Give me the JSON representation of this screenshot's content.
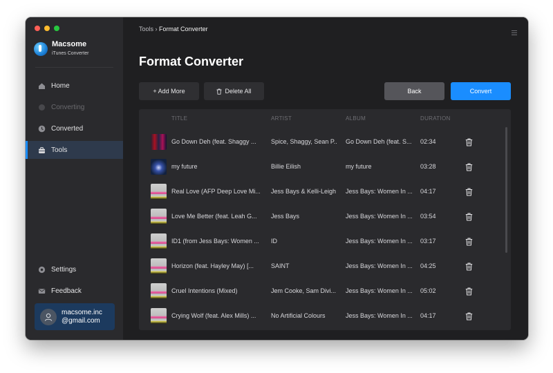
{
  "window": {
    "traffic_lights": [
      "close",
      "minimize",
      "zoom"
    ]
  },
  "sidebar": {
    "brand_name": "Macsome",
    "brand_subtitle": "iTunes Converter",
    "items": [
      {
        "label": "Home",
        "icon": "home-icon",
        "state": "normal"
      },
      {
        "label": "Converting",
        "icon": "converting-icon",
        "state": "disabled"
      },
      {
        "label": "Converted",
        "icon": "clock-icon",
        "state": "normal"
      },
      {
        "label": "Tools",
        "icon": "toolbox-icon",
        "state": "active"
      }
    ],
    "bottom_items": [
      {
        "label": "Settings",
        "icon": "gear-icon"
      },
      {
        "label": "Feedback",
        "icon": "mail-icon"
      }
    ],
    "user": {
      "line1": "macsome.inc",
      "line2": "@gmail.com"
    }
  },
  "header": {
    "breadcrumb_parent": "Tools",
    "breadcrumb_separator": "›",
    "breadcrumb_current": "Format Converter"
  },
  "main": {
    "title": "Format Converter",
    "buttons": {
      "add_more": "+ Add More",
      "delete_all": "Delete All",
      "back": "Back",
      "convert": "Convert"
    },
    "accent_color": "#1a8dff",
    "table": {
      "columns": [
        "TITLE",
        "ARTIST",
        "ALBUM",
        "DURATION"
      ],
      "rows": [
        {
          "thumb": "t1",
          "title": "Go Down Deh (feat. Shaggy ...",
          "artist": "Spice, Shaggy, Sean P...",
          "album": "Go Down Deh (feat. S...",
          "duration": "02:34"
        },
        {
          "thumb": "t2",
          "title": "my future",
          "artist": "Billie Eilish",
          "album": "my future",
          "duration": "03:28"
        },
        {
          "thumb": "t3",
          "title": "Real Love (AFP Deep Love Mi...",
          "artist": "Jess Bays & Kelli-Leigh",
          "album": "Jess Bays: Women In ...",
          "duration": "04:17"
        },
        {
          "thumb": "t3",
          "title": "Love Me Better (feat. Leah G...",
          "artist": "Jess Bays",
          "album": "Jess Bays: Women In ...",
          "duration": "03:54"
        },
        {
          "thumb": "t3",
          "title": "ID1 (from Jess Bays: Women ...",
          "artist": "ID",
          "album": "Jess Bays: Women In ...",
          "duration": "03:17"
        },
        {
          "thumb": "t3",
          "title": "Horizon (feat. Hayley May) [...",
          "artist": "SAINT",
          "album": "Jess Bays: Women In ...",
          "duration": "04:25"
        },
        {
          "thumb": "t3",
          "title": "Cruel Intentions (Mixed)",
          "artist": "Jem Cooke, Sam Divi...",
          "album": "Jess Bays: Women In ...",
          "duration": "05:02"
        },
        {
          "thumb": "t3",
          "title": "Crying Wolf (feat. Alex Mills) ...",
          "artist": "No Artificial Colours",
          "album": "Jess Bays: Women In ...",
          "duration": "04:17"
        }
      ]
    }
  }
}
